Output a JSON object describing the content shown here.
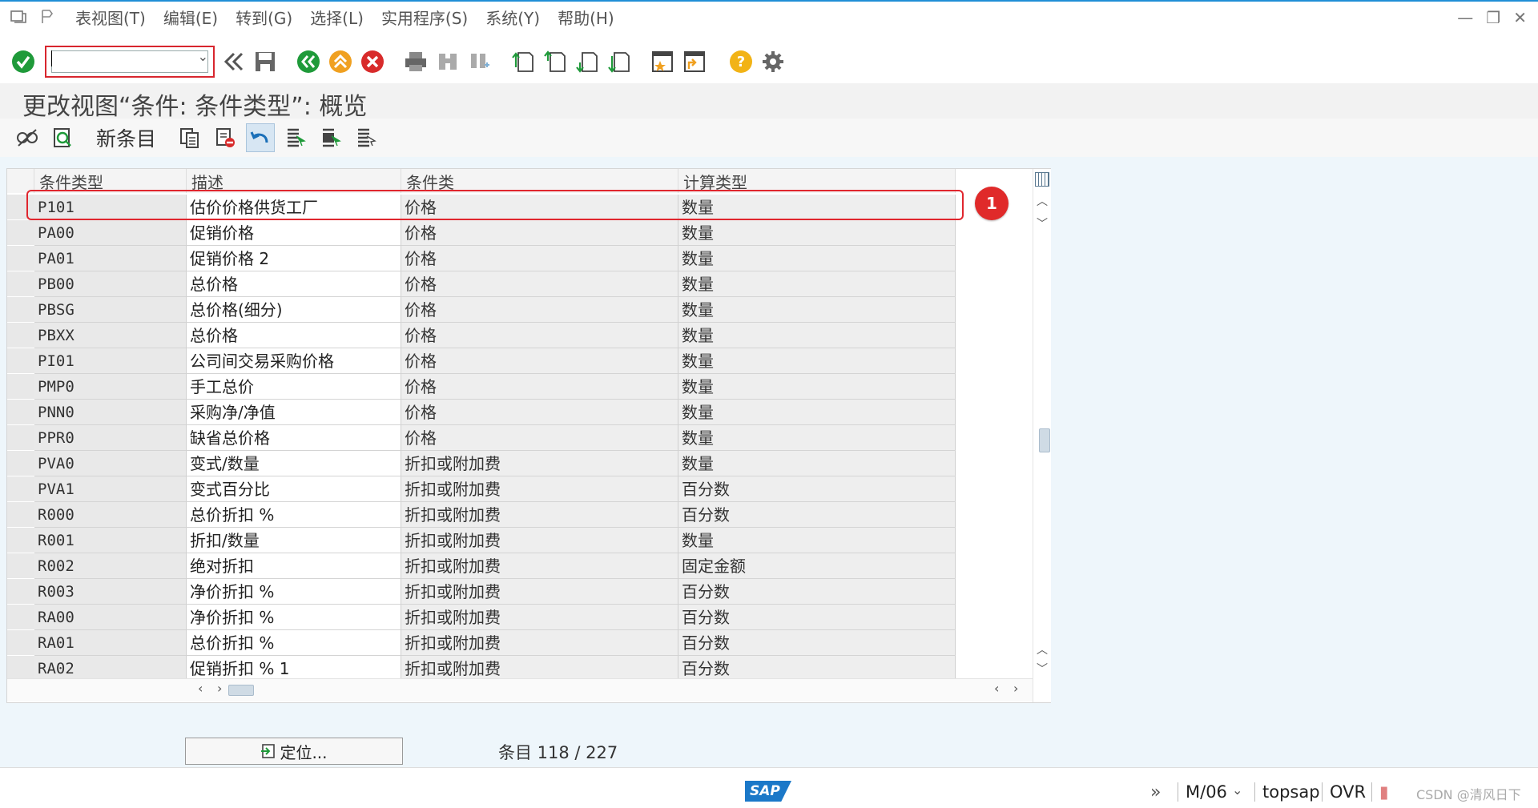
{
  "menu": {
    "items": [
      "表视图(T)",
      "编辑(E)",
      "转到(G)",
      "选择(L)",
      "实用程序(S)",
      "系统(Y)",
      "帮助(H)"
    ]
  },
  "title": "更改视图“条件: 条件类型”: 概览",
  "app_toolbar": {
    "new_entry_label": "新条目"
  },
  "table": {
    "columns": [
      "条件类型",
      "描述",
      "条件类",
      "计算类型"
    ],
    "rows": [
      [
        "P101",
        "估价价格供货工厂",
        "价格",
        "数量"
      ],
      [
        "PA00",
        "促销价格",
        "价格",
        "数量"
      ],
      [
        "PA01",
        "促销价格 2",
        "价格",
        "数量"
      ],
      [
        "PB00",
        "总价格",
        "价格",
        "数量"
      ],
      [
        "PBSG",
        "总价格(细分)",
        "价格",
        "数量"
      ],
      [
        "PBXX",
        "总价格",
        "价格",
        "数量"
      ],
      [
        "PI01",
        "公司间交易采购价格",
        "价格",
        "数量"
      ],
      [
        "PMP0",
        "手工总价",
        "价格",
        "数量"
      ],
      [
        "PNN0",
        "采购净/净值",
        "价格",
        "数量"
      ],
      [
        "PPR0",
        "缺省总价格",
        "价格",
        "数量"
      ],
      [
        "PVA0",
        "变式/数量",
        "折扣或附加费",
        "数量"
      ],
      [
        "PVA1",
        "变式百分比",
        "折扣或附加费",
        "百分数"
      ],
      [
        "R000",
        "总价折扣 %",
        "折扣或附加费",
        "百分数"
      ],
      [
        "R001",
        "折扣/数量",
        "折扣或附加费",
        "数量"
      ],
      [
        "R002",
        "绝对折扣",
        "折扣或附加费",
        "固定金额"
      ],
      [
        "R003",
        "净价折扣 %",
        "折扣或附加费",
        "百分数"
      ],
      [
        "RA00",
        "净价折扣 %",
        "折扣或附加费",
        "百分数"
      ],
      [
        "RA01",
        "总价折扣 %",
        "折扣或附加费",
        "百分数"
      ],
      [
        "RA02",
        "促销折扣 % 1",
        "折扣或附加费",
        "百分数"
      ]
    ]
  },
  "annotation": {
    "badge": "1"
  },
  "footer": {
    "position_button": "定位...",
    "entries_text": "条目 118 / 227"
  },
  "status": {
    "logo": "SAP",
    "session": "M/06",
    "server": "topsap",
    "mode": "OVR",
    "watermark": "CSDN @清风日下"
  }
}
